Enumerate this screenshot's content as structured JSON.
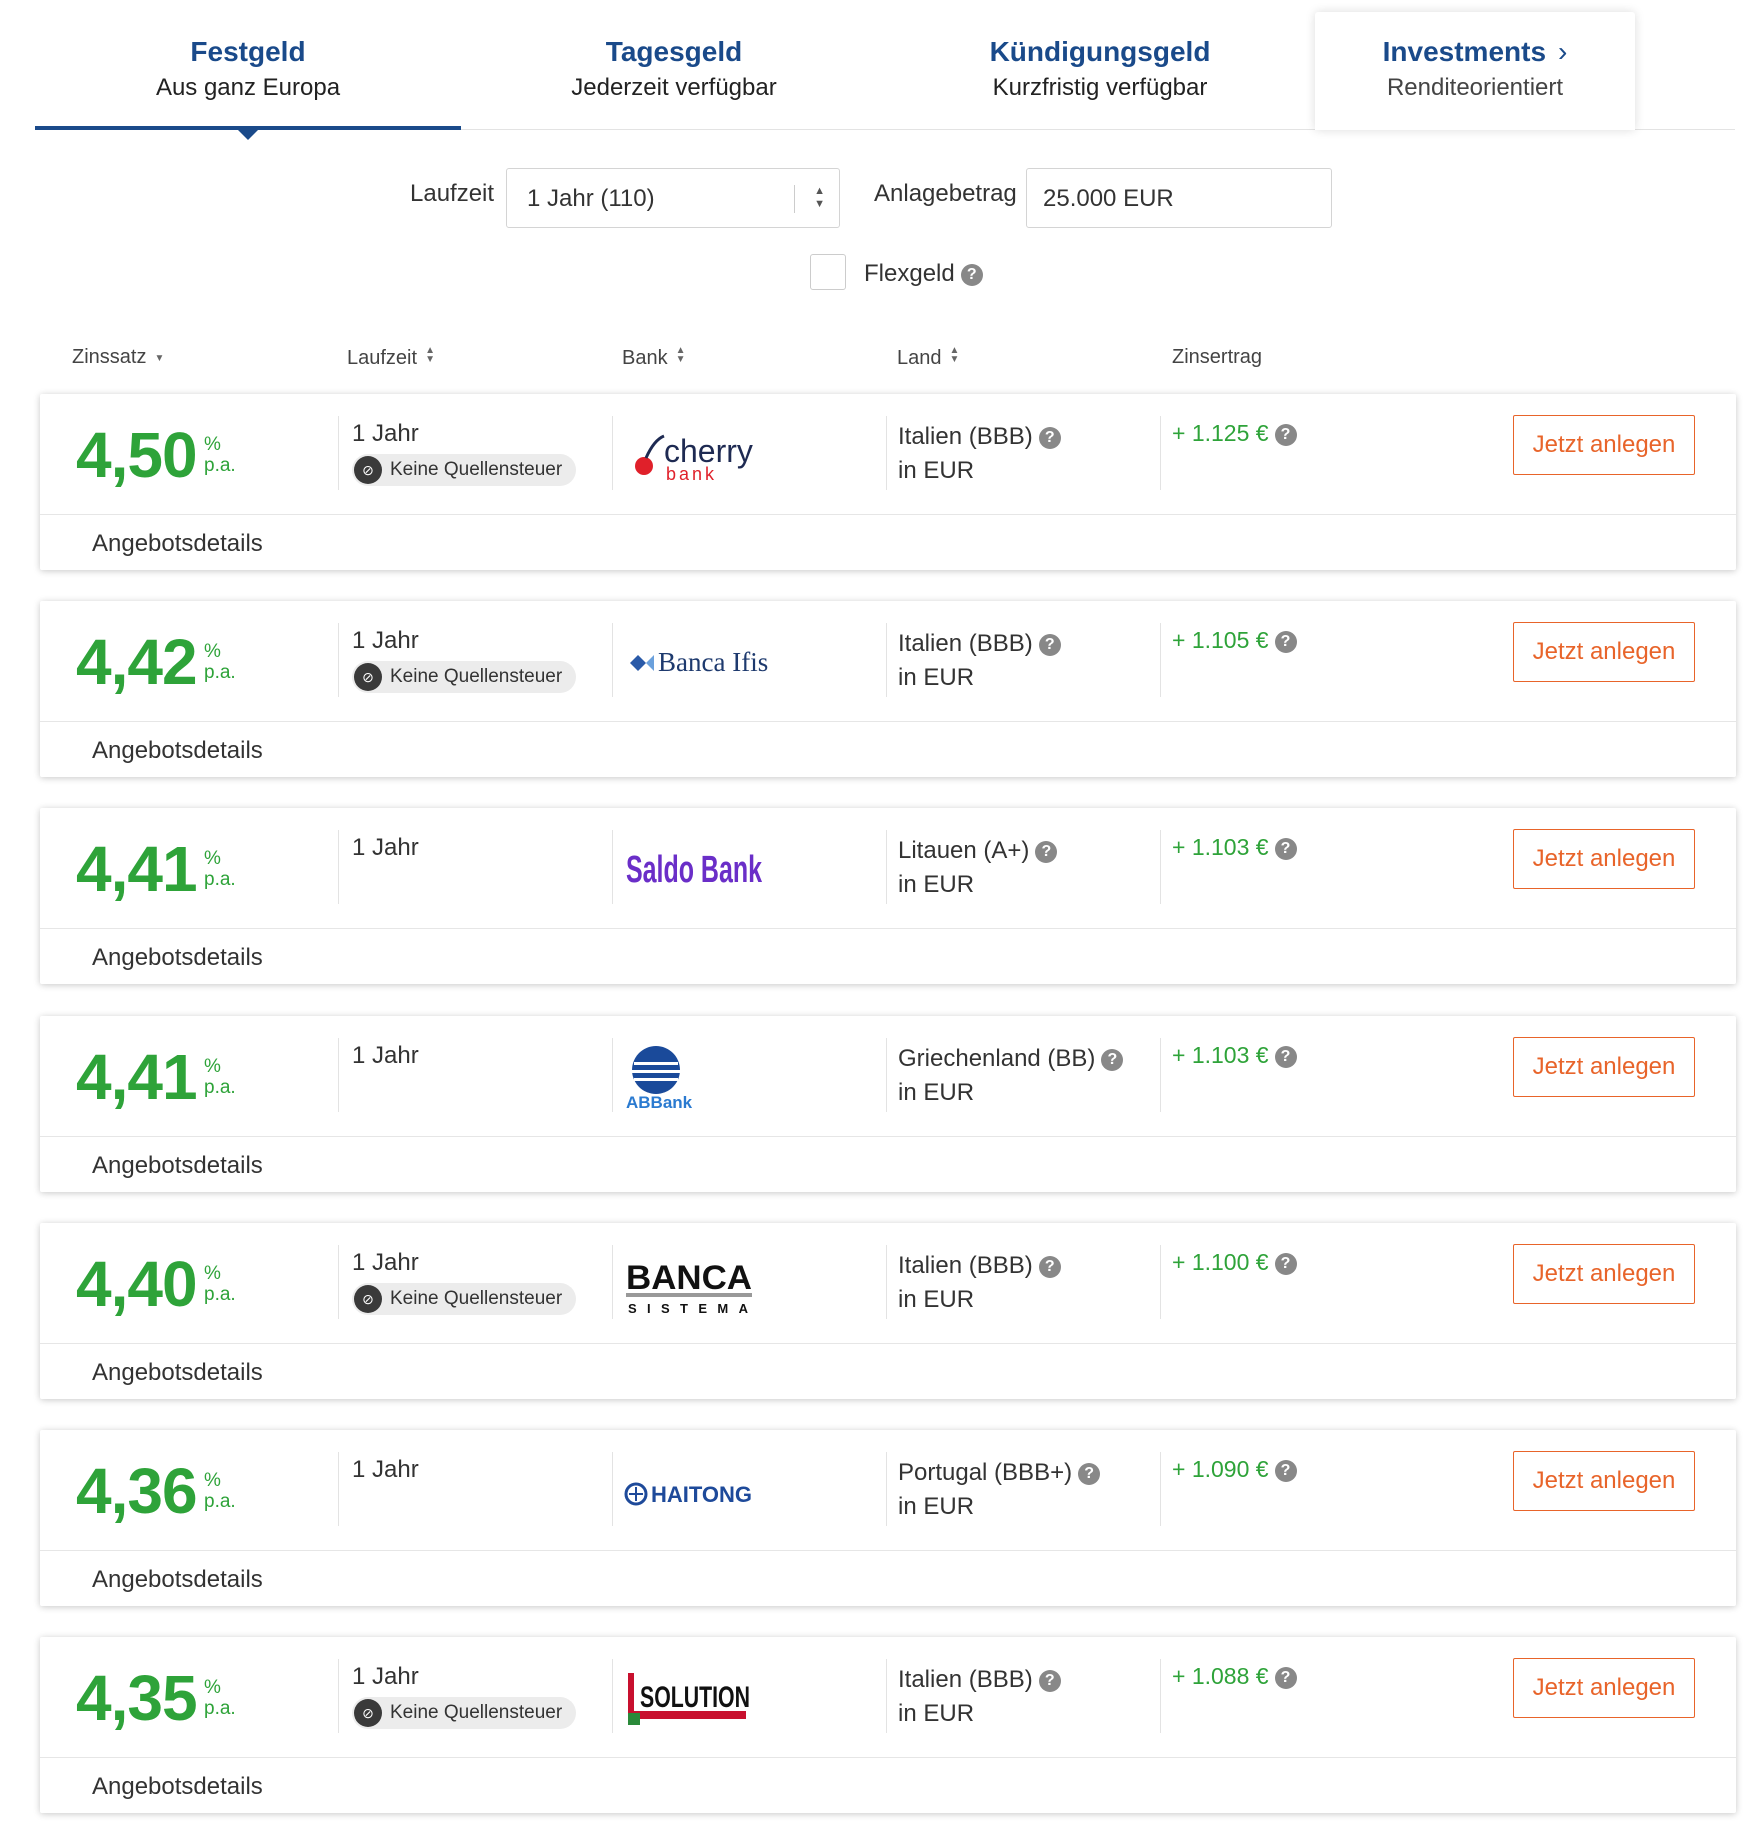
{
  "tabs": [
    {
      "title": "Festgeld",
      "subtitle": "Aus ganz Europa"
    },
    {
      "title": "Tagesgeld",
      "subtitle": "Jederzeit verfügbar"
    },
    {
      "title": "Kündigungsgeld",
      "subtitle": "Kurzfristig verfügbar"
    },
    {
      "title": "Investments",
      "subtitle": "Renditeorientiert"
    }
  ],
  "filters": {
    "laufzeit_label": "Laufzeit",
    "laufzeit_value": "1 Jahr (110)",
    "anlagebetrag_label": "Anlagebetrag",
    "anlagebetrag_value": "25.000 EUR",
    "flexgeld_label": "Flexgeld"
  },
  "columns": {
    "zinssatz": "Zinssatz",
    "laufzeit": "Laufzeit",
    "bank": "Bank",
    "land": "Land",
    "zinsertrag": "Zinsertrag"
  },
  "common": {
    "rate_pct": "%",
    "rate_pa": "p.a.",
    "currency_line": "in EUR",
    "badge": "Keine Quellensteuer",
    "button": "Jetzt anlegen",
    "details": "Angebotsdetails"
  },
  "offers": [
    {
      "rate": "4,50",
      "term": "1 Jahr",
      "badge": true,
      "bank": "cherry bank",
      "logo": {
        "top": "cherry",
        "bottom": "bank"
      },
      "country": "Italien (BBB)",
      "earning": "+ 1.125 €"
    },
    {
      "rate": "4,42",
      "term": "1 Jahr",
      "badge": true,
      "bank": "Banca Ifis",
      "logo": {
        "top": "Banca Ifis"
      },
      "country": "Italien (BBB)",
      "earning": "+ 1.105 €"
    },
    {
      "rate": "4,41",
      "term": "1 Jahr",
      "badge": false,
      "bank": "Saldo Bank",
      "logo": {
        "top": "Saldo Bank"
      },
      "country": "Litauen (A+)",
      "earning": "+ 1.103 €"
    },
    {
      "rate": "4,41",
      "term": "1 Jahr",
      "badge": false,
      "bank": "ABBank",
      "logo": {
        "top": "ABBank"
      },
      "country": "Griechenland (BB)",
      "earning": "+ 1.103 €"
    },
    {
      "rate": "4,40",
      "term": "1 Jahr",
      "badge": true,
      "bank": "Banca Sistema",
      "logo": {
        "top": "BANCA",
        "bottom": "SISTEMA"
      },
      "country": "Italien (BBB)",
      "earning": "+ 1.100 €"
    },
    {
      "rate": "4,36",
      "term": "1 Jahr",
      "badge": false,
      "bank": "Haitong",
      "logo": {
        "top": "HAITONG"
      },
      "country": "Portugal (BBB+)",
      "earning": "+ 1.090 €"
    },
    {
      "rate": "4,35",
      "term": "1 Jahr",
      "badge": true,
      "bank": "Solution",
      "logo": {
        "top": "SOLUTION"
      },
      "country": "Italien (BBB)",
      "earning": "+ 1.088 €"
    }
  ],
  "colors": {
    "brand": "#1a4a8a",
    "rate_green": "#2ea339",
    "cta_orange": "#e8642a"
  }
}
